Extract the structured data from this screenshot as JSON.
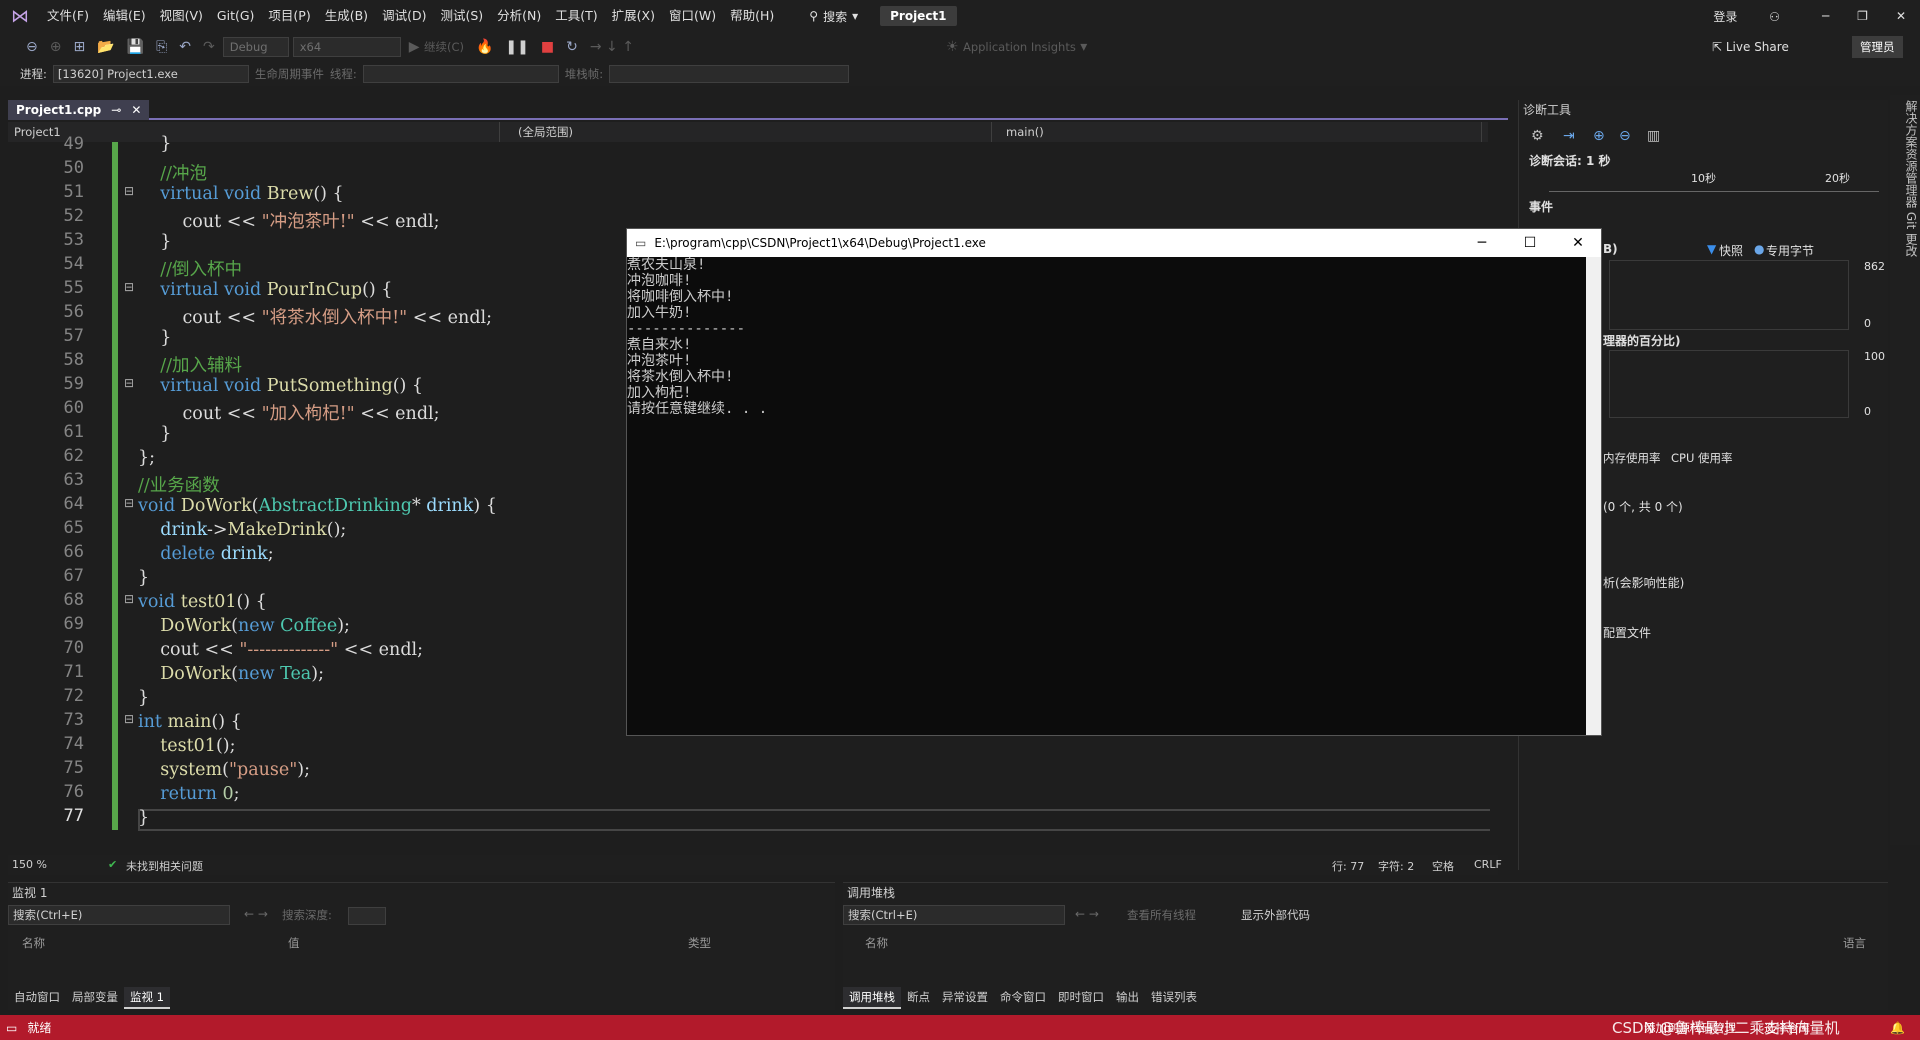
{
  "menubar": {
    "items": [
      "文件(F)",
      "编辑(E)",
      "视图(V)",
      "Git(G)",
      "项目(P)",
      "生成(B)",
      "调试(D)",
      "测试(S)",
      "分析(N)",
      "工具(T)",
      "扩展(X)",
      "窗口(W)",
      "帮助(H)"
    ],
    "search": "搜索",
    "project": "Project1",
    "login": "登录"
  },
  "toolbar1": {
    "config": "Debug",
    "platform": "x64",
    "continue": "继续(C)",
    "app_insights": "Application Insights",
    "live_share": "Live Share",
    "admin": "管理员"
  },
  "toolbar2": {
    "process_label": "进程:",
    "process_value": "[13620] Project1.exe",
    "lifecycle": "生命周期事件",
    "thread": "线程:",
    "stack": "堆栈帧:"
  },
  "editor": {
    "tab": "Project1.cpp",
    "nav_project": "Project1",
    "nav_scope": "(全局范围)",
    "nav_member": "main()",
    "zoom": "150 %",
    "issues": "未找到相关问题",
    "row": "行: 77",
    "col": "字符: 2",
    "space": "空格",
    "eol": "CRLF",
    "line_numbers": [
      "49",
      "50",
      "51",
      "52",
      "53",
      "54",
      "55",
      "56",
      "57",
      "58",
      "59",
      "60",
      "61",
      "62",
      "63",
      "64",
      "65",
      "66",
      "67",
      "68",
      "69",
      "70",
      "71",
      "72",
      "73",
      "74",
      "75",
      "76",
      "77"
    ]
  },
  "console": {
    "title": "E:\\program\\cpp\\CSDN\\Project1\\x64\\Debug\\Project1.exe",
    "lines": [
      "煮农夫山泉!",
      "冲泡咖啡!",
      "将咖啡倒入杯中!",
      "加入牛奶!",
      "--------------",
      "煮自来水!",
      "冲泡茶叶!",
      "将茶水倒入杯中!",
      "加入枸杞!",
      "请按任意键继续. . ."
    ]
  },
  "diag": {
    "title": "诊断工具",
    "session": "诊断会话: 1 秒",
    "t10": "10秒",
    "t20": "20秒",
    "events": "事件",
    "snapshot": "快照",
    "private_bytes": "专用字节",
    "v862": "862",
    "v0a": "0",
    "cpu_label": "理器的百分比)",
    "v100": "100",
    "v0b": "0",
    "tab_mem": "内存使用率",
    "tab_cpu": "CPU 使用率",
    "count": "(0 个, 共 0 个)",
    "analysis": "析(会影响性能)",
    "profile": "配置文件",
    "mem_suffix": "B)"
  },
  "rightstrip": "解决方案资源管理器  Git 更改",
  "watch": {
    "title": "监视 1",
    "search": "搜索(Ctrl+E)",
    "depth": "搜索深度:",
    "col_name": "名称",
    "col_value": "值",
    "col_type": "类型",
    "tabs": [
      "自动窗口",
      "局部变量",
      "监视 1"
    ]
  },
  "callstack": {
    "title": "调用堆栈",
    "search": "搜索(Ctrl+E)",
    "show_all": "查看所有线程",
    "show_external": "显示外部代码",
    "col_name": "名称",
    "col_lang": "语言",
    "tabs": [
      "调用堆栈",
      "断点",
      "异常设置",
      "命令窗口",
      "即时窗口",
      "输出",
      "错误列表"
    ]
  },
  "statusbar": {
    "ready": "就绪",
    "add_source": "添加到源代码管理",
    "select_repo": "选择仓库",
    "watermark": "CSDN @鲁棒最小二乘支持向量机"
  }
}
